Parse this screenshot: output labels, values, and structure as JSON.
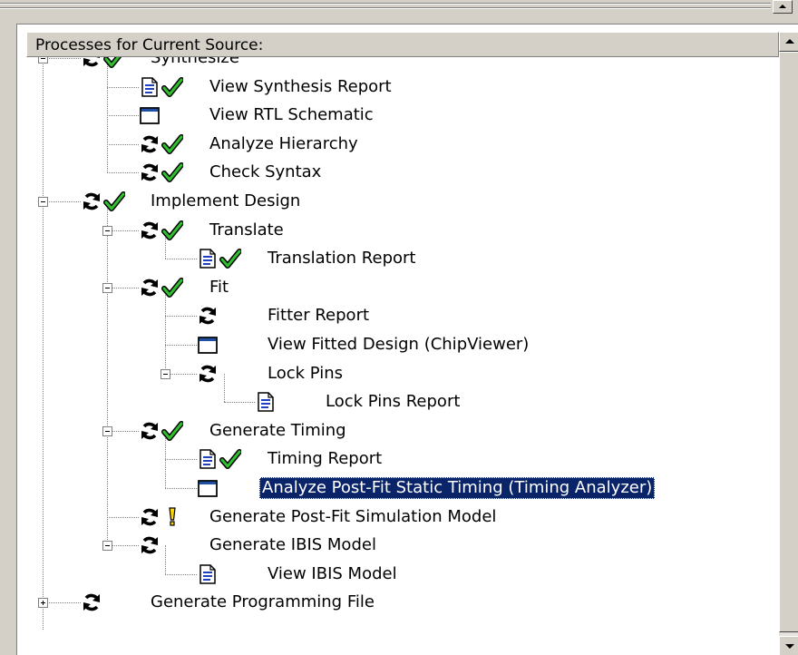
{
  "header": {
    "title": "Processes for Current Source:"
  },
  "tree": [
    {
      "label": "Synthesize",
      "icons": [
        "refresh-icon",
        "check-icon"
      ],
      "expander": "minus"
    },
    {
      "label": "View Synthesis Report",
      "icons": [
        "report-icon",
        "check-icon"
      ]
    },
    {
      "label": "View RTL Schematic",
      "icons": [
        "window-icon"
      ]
    },
    {
      "label": "Analyze Hierarchy",
      "icons": [
        "refresh-icon",
        "check-icon"
      ]
    },
    {
      "label": "Check Syntax",
      "icons": [
        "refresh-icon",
        "check-icon"
      ]
    },
    {
      "label": "Implement Design",
      "icons": [
        "refresh-icon",
        "check-icon"
      ],
      "expander": "minus"
    },
    {
      "label": "Translate",
      "icons": [
        "refresh-icon",
        "check-icon"
      ],
      "expander": "minus"
    },
    {
      "label": "Translation Report",
      "icons": [
        "report-icon",
        "check-icon"
      ]
    },
    {
      "label": "Fit",
      "icons": [
        "refresh-icon",
        "check-icon"
      ],
      "expander": "minus"
    },
    {
      "label": "Fitter Report",
      "icons": [
        "refresh-icon"
      ]
    },
    {
      "label": "View Fitted Design (ChipViewer)",
      "icons": [
        "window-icon"
      ]
    },
    {
      "label": "Lock Pins",
      "icons": [
        "refresh-icon"
      ],
      "expander": "minus"
    },
    {
      "label": "Lock Pins Report",
      "icons": [
        "report-icon"
      ]
    },
    {
      "label": "Generate Timing",
      "icons": [
        "refresh-icon",
        "check-icon"
      ],
      "expander": "minus"
    },
    {
      "label": "Timing Report",
      "icons": [
        "report-icon",
        "check-icon"
      ]
    },
    {
      "label": "Analyze Post-Fit Static Timing (Timing Analyzer)",
      "icons": [
        "window-icon"
      ],
      "selected": true
    },
    {
      "label": "Generate Post-Fit Simulation Model",
      "icons": [
        "refresh-icon",
        "warning-icon"
      ]
    },
    {
      "label": "Generate IBIS Model",
      "icons": [
        "refresh-icon"
      ],
      "expander": "minus"
    },
    {
      "label": "View IBIS Model",
      "icons": [
        "report-icon"
      ]
    },
    {
      "label": "Generate Programming File",
      "icons": [
        "refresh-icon"
      ],
      "expander": "plus"
    }
  ]
}
